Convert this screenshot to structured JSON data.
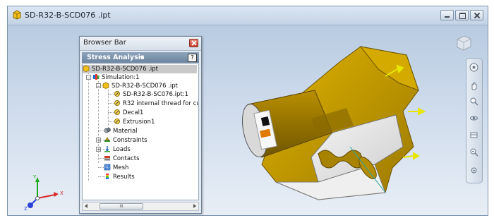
{
  "window": {
    "title": "SD-R32-B-SCD076 .ipt"
  },
  "browser": {
    "title": "Browser Bar",
    "mode_label": "Stress Analysis",
    "help_label": "?",
    "tree": [
      {
        "label": "SD-R32-B-SCD076 .ipt"
      },
      {
        "label": "Simulation:1"
      },
      {
        "label": "SD-R32-B-SCD076 .ipt"
      },
      {
        "label": "SD-R32-B-SC076.ipt:1"
      },
      {
        "label": "R32 internal thread for cu"
      },
      {
        "label": "Decal1"
      },
      {
        "label": "Extrusion1"
      },
      {
        "label": "Material"
      },
      {
        "label": "Constraints"
      },
      {
        "label": "Loads"
      },
      {
        "label": "Contacts"
      },
      {
        "label": "Mesh"
      },
      {
        "label": "Results"
      }
    ],
    "scroll_thumb_label": "III"
  },
  "axes": {
    "x": "X",
    "y": "Y",
    "z": "Z"
  },
  "colors": {
    "model_gold": "#c9a000",
    "arrow_yellow": "#e6e600",
    "panel_header": "#7d93ad"
  }
}
